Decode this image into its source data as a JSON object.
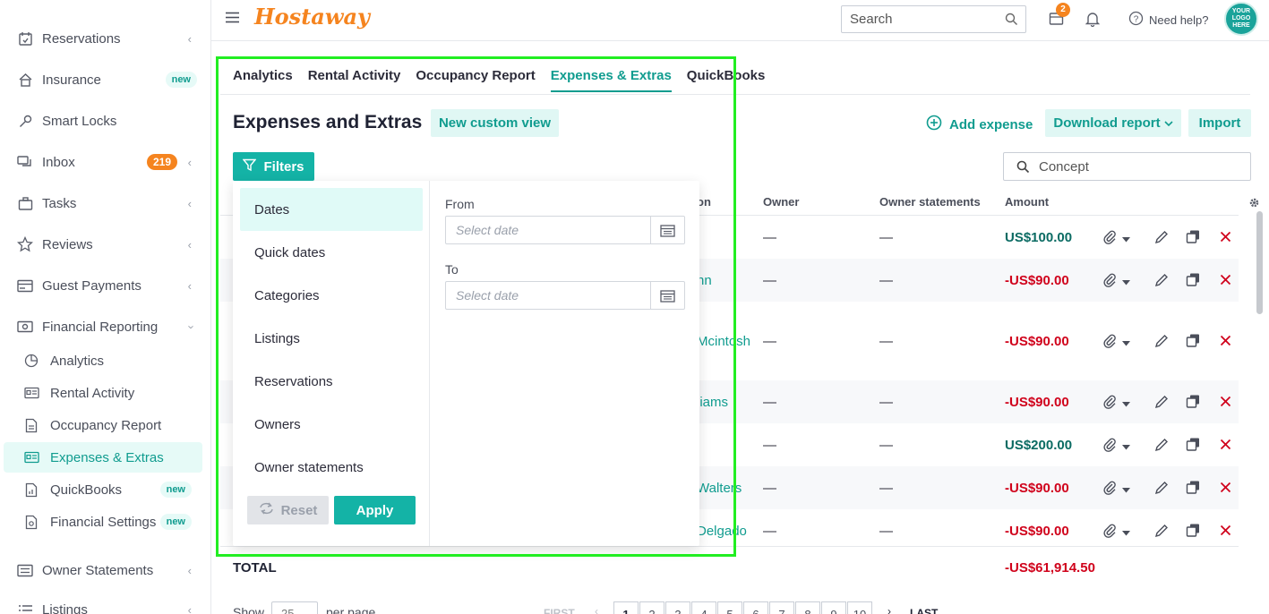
{
  "sidebar": {
    "items": [
      {
        "label": "Reservations",
        "icon": "calendar-check-icon"
      },
      {
        "label": "Insurance",
        "icon": "home-icon",
        "badge": "new"
      },
      {
        "label": "Smart Locks",
        "icon": "key-icon"
      },
      {
        "label": "Inbox",
        "icon": "chat-icon",
        "count": "219"
      },
      {
        "label": "Tasks",
        "icon": "briefcase-icon"
      },
      {
        "label": "Reviews",
        "icon": "star-icon"
      },
      {
        "label": "Guest Payments",
        "icon": "card-icon"
      },
      {
        "label": "Financial Reporting",
        "icon": "money-icon"
      }
    ],
    "sub_items": [
      {
        "label": "Analytics",
        "icon": "pie-chart-icon"
      },
      {
        "label": "Rental Activity",
        "icon": "id-card-icon"
      },
      {
        "label": "Occupancy Report",
        "icon": "document-icon"
      },
      {
        "label": "Expenses & Extras",
        "icon": "id-card-icon"
      },
      {
        "label": "QuickBooks",
        "icon": "document-chart-icon",
        "badge": "new"
      },
      {
        "label": "Financial Settings",
        "icon": "settings-doc-icon",
        "badge": "new"
      }
    ],
    "bottom_items": [
      {
        "label": "Owner Statements",
        "icon": "statement-icon"
      },
      {
        "label": "Listings",
        "icon": "list-icon"
      }
    ]
  },
  "topbar": {
    "logo": "Hostaway",
    "search_placeholder": "Search",
    "calendar_badge": "2",
    "help_label": "Need help?",
    "avatar_text": "YOUR LOGO HERE"
  },
  "tabs": [
    "Analytics",
    "Rental Activity",
    "Occupancy Report",
    "Expenses & Extras",
    "QuickBooks"
  ],
  "page": {
    "title": "Expenses and Extras",
    "new_view_label": "New custom view",
    "add_expense_label": "Add expense",
    "download_label": "Download report",
    "import_label": "Import",
    "filters_label": "Filters",
    "concept_placeholder": "Concept"
  },
  "table": {
    "headers": {
      "guest": "on",
      "owner": "Owner",
      "owner_statements": "Owner statements",
      "amount": "Amount"
    },
    "rows": [
      {
        "guest": "",
        "owner": "—",
        "statement": "—",
        "amount": "US$100.00",
        "sign": "pos"
      },
      {
        "guest": "nn",
        "owner": "—",
        "statement": "—",
        "amount": "-US$90.00",
        "sign": "neg"
      },
      {
        "guest": "Mcintosh",
        "owner": "—",
        "statement": "—",
        "amount": "-US$90.00",
        "sign": "neg"
      },
      {
        "guest": "liams",
        "owner": "—",
        "statement": "—",
        "amount": "-US$90.00",
        "sign": "neg"
      },
      {
        "guest": "",
        "owner": "—",
        "statement": "—",
        "amount": "US$200.00",
        "sign": "pos"
      },
      {
        "guest": "Walters",
        "owner": "—",
        "statement": "—",
        "amount": "-US$90.00",
        "sign": "neg"
      },
      {
        "guest": "Delgado",
        "owner": "—",
        "statement": "—",
        "amount": "-US$90.00",
        "sign": "neg"
      }
    ],
    "total_label": "TOTAL",
    "total_amount": "-US$61,914.50"
  },
  "pagination": {
    "show_label": "Show",
    "per_page_value": "25",
    "per_page_label": "per page",
    "first_label": "FIRST",
    "last_label": "LAST",
    "pages": [
      "1",
      "2",
      "3",
      "4",
      "5",
      "6",
      "7",
      "8",
      "9",
      "10"
    ]
  },
  "filter_popup": {
    "items": [
      "Dates",
      "Quick dates",
      "Categories",
      "Listings",
      "Reservations",
      "Owners",
      "Owner statements"
    ],
    "from_label": "From",
    "to_label": "To",
    "date_placeholder": "Select date",
    "reset_label": "Reset",
    "apply_label": "Apply"
  },
  "colors": {
    "accent": "#14b3a6",
    "brand": "#f5841f",
    "negative": "#d0021b",
    "positive": "#0b6b63",
    "highlight": "#22ee22"
  }
}
